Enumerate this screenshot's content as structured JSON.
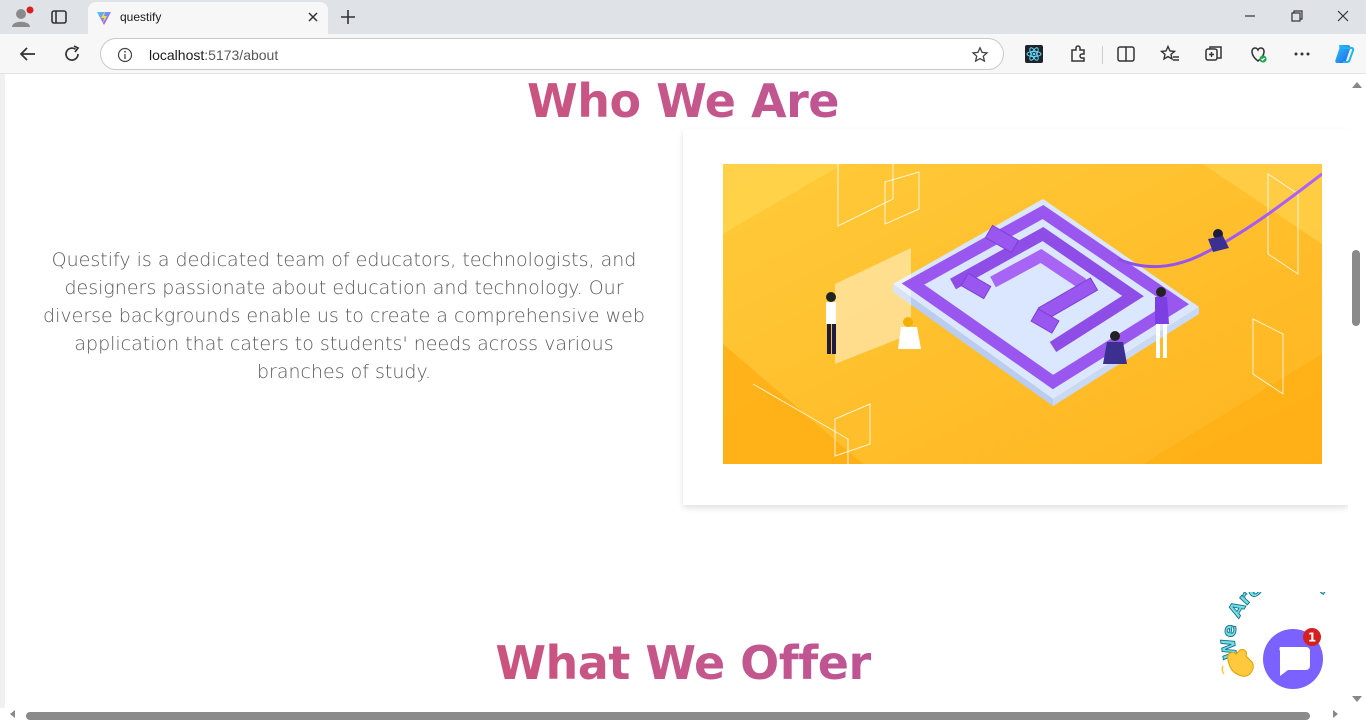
{
  "browser": {
    "tab_title": "questify",
    "url_host": "localhost",
    "url_path": ":5173/about"
  },
  "page": {
    "heading_who": "Who We Are",
    "intro_text": "Questify is a dedicated team of educators, technologists, and designers passionate about education and technology. Our diverse backgrounds enable us to create a comprehensive web application that caters to students' needs across various branches of study.",
    "heading_offer": "What We Offer"
  },
  "chat_widget": {
    "banner_text": "We Are Here!",
    "badge_count": "1"
  },
  "colors": {
    "heading_gradient_start": "#d94a5e",
    "heading_gradient_end": "#a84cb4",
    "illustration_bg": "#ffc233",
    "chat_button": "#7b61ff"
  }
}
